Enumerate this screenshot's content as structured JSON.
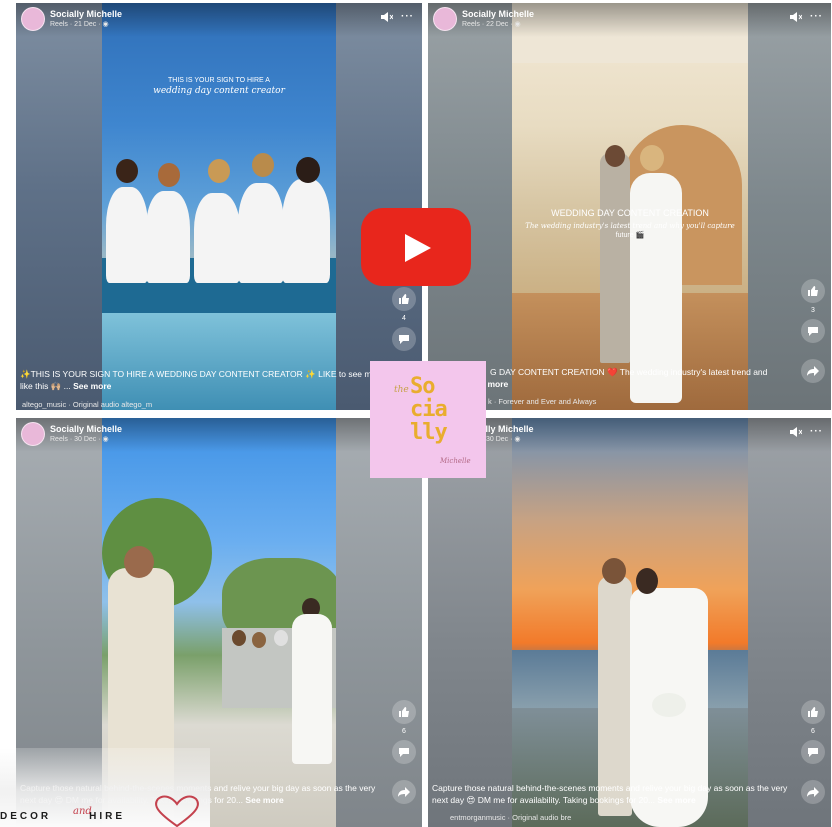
{
  "tiles": [
    {
      "poster": "Socially Michelle",
      "meta": "Reels · 21 Dec · ",
      "overlay_line1": "THIS IS YOUR SIGN TO HIRE A",
      "overlay_line2": "wedding day content creator",
      "like_count": "4",
      "caption": "✨THIS IS YOUR SIGN TO HIRE A WEDDING DAY CONTENT CREATOR ✨ LIKE to see more videos like this 🙌🏼 ...",
      "see_more": "See more",
      "audio": "altego_music · Original audio      altego_m"
    },
    {
      "poster": "Socially Michelle",
      "meta": "Reels · 22 Dec · ",
      "overlay_line1": "WEDDING DAY CONTENT CREATION",
      "overlay_line2": "The wedding industry's latest trend and why you'll capture",
      "overlay_line3": "future 🎬",
      "like_count": "3",
      "caption": "G DAY CONTENT CREATION ❤️ The wedding industry's latest trend and",
      "caption_line2": "le more",
      "see_more": "",
      "audio": "k · Forever and Ever and Always"
    },
    {
      "poster": "Socially Michelle",
      "meta": "Reels · 30 Dec · ",
      "like_count": "6",
      "caption": "Capture those natural behind-the-scenes moments and relive your big day as soon as the very next day 😍 DM me for availability. Taking bookings for 20...",
      "see_more": "See more",
      "audio": ""
    },
    {
      "poster": "ially Michelle",
      "meta": "30 Dec · ",
      "like_count": "6",
      "caption": "Capture those natural behind-the-scenes moments and relive your big day as soon as the very next day 😍 DM me for availability. Taking bookings for 20...",
      "see_more": "See more",
      "audio": "entmorganmusic · Original audio      bre"
    }
  ],
  "logo": {
    "the": "the",
    "line1": "So",
    "line2": "cia",
    "line3": "lly",
    "sub": "Michelle"
  },
  "decor": {
    "left": "DECOR",
    "and": "and",
    "right": "HIRE"
  },
  "colors": {
    "youtube_red": "#e8261c",
    "logo_bg": "#f3c6ec",
    "logo_gold": "#e9ad2e"
  },
  "icons": [
    "sound-icon",
    "more-icon",
    "like-icon",
    "comment-icon",
    "share-icon",
    "play-icon"
  ]
}
